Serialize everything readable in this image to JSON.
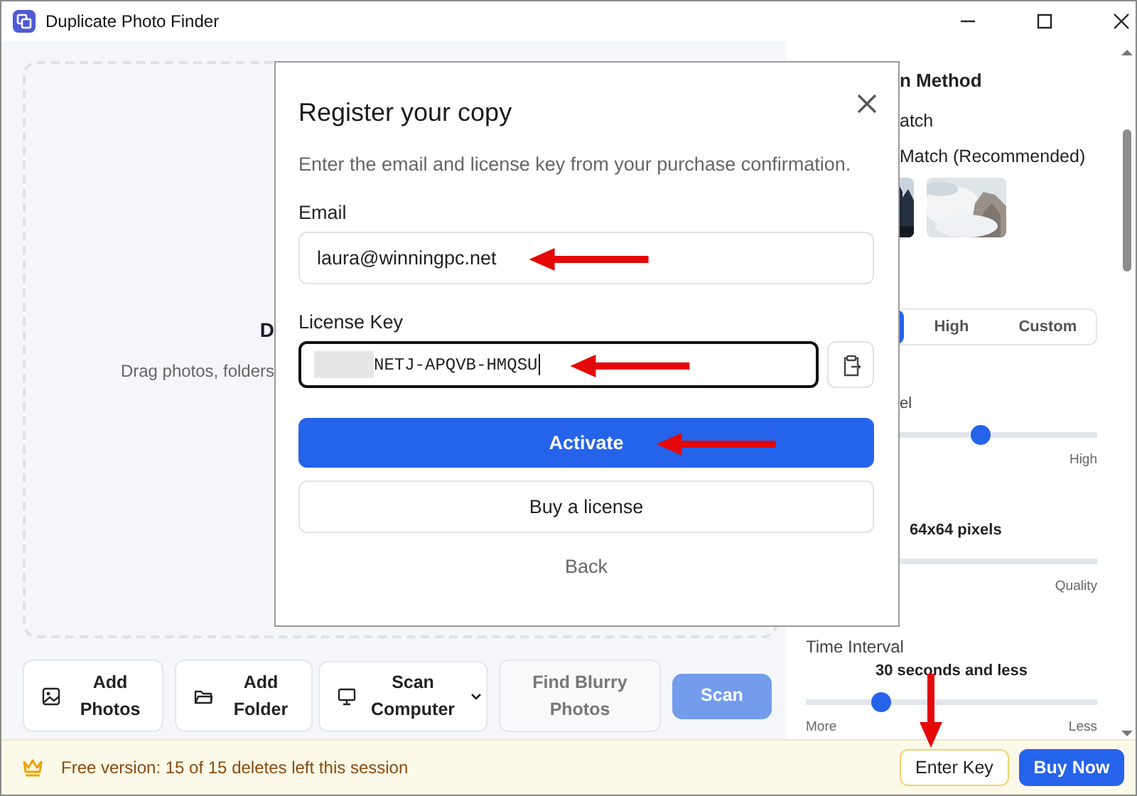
{
  "window": {
    "title": "Duplicate Photo Finder"
  },
  "drop_zone": {
    "heading": "D",
    "hint": "Drag photos, folders"
  },
  "toolbar": [
    {
      "label": "Add Photos",
      "kind": "photos",
      "disabled": false
    },
    {
      "label": "Add Folder",
      "kind": "folder",
      "disabled": false
    },
    {
      "label": "Scan Computer",
      "kind": "computer",
      "disabled": false
    },
    {
      "label": "Find Blurry Photos",
      "kind": "plain",
      "disabled": true
    },
    {
      "label": "Scan",
      "kind": "primary",
      "disabled": true
    }
  ],
  "settings": {
    "heading": "n Method",
    "options": [
      "atch",
      "Match (Recommended)"
    ],
    "thumbnails": [
      {
        "kind": "picture"
      },
      {
        "kind": "picture"
      }
    ],
    "segments": [
      {
        "selected": true
      },
      {
        "label": "High",
        "selected": false
      },
      {
        "label": "Custom",
        "selected": false
      }
    ],
    "detection": {
      "label": "el",
      "level": 0.6,
      "max_label": "High"
    },
    "quality": {
      "value": "64x64 pixels",
      "max_label": "Quality"
    },
    "time": {
      "label": "Time Interval",
      "value": "30 seconds and less",
      "level": 0.26,
      "min_label": "More",
      "max_label": "Less"
    }
  },
  "dialog": {
    "title": "Register your copy",
    "subtitle": "Enter the email and license key from your purchase confirmation.",
    "email_label": "Email",
    "email": "laura@winningpc.net",
    "key_label": "License Key",
    "key_redacted": true,
    "key": "NETJ-APQVB-HMQSU",
    "activate": "Activate",
    "buy": "Buy a license",
    "back": "Back"
  },
  "status_bar": {
    "message": "Free version: 15 of 15 deletes left this session",
    "enter_key": "Enter Key",
    "buy_now": "Buy Now"
  }
}
